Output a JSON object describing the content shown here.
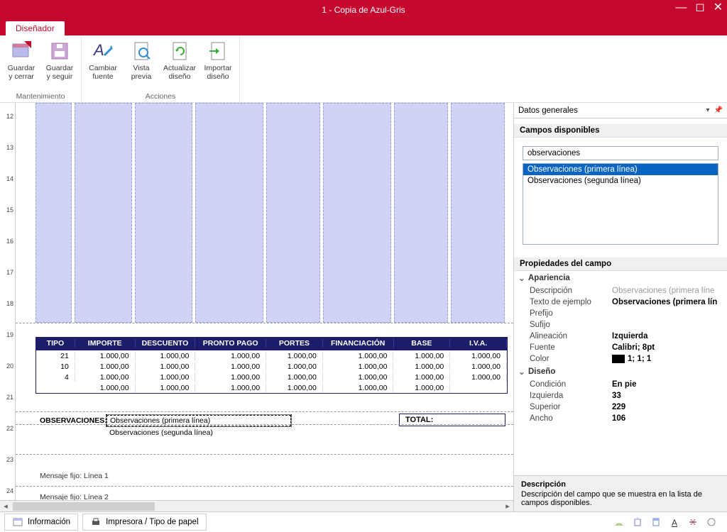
{
  "title": "1 - Copia de Azul-Gris",
  "tab": "Diseñador",
  "ribbon": {
    "groups": [
      {
        "title": "Mantenimiento",
        "items": [
          {
            "label": "Guardar y cerrar",
            "icon": "save-close"
          },
          {
            "label": "Guardar y seguir",
            "icon": "save"
          }
        ]
      },
      {
        "title": "Acciones",
        "items": [
          {
            "label": "Cambiar fuente",
            "icon": "font"
          },
          {
            "label": "Vista previa",
            "icon": "preview"
          },
          {
            "label": "Actualizar diseño",
            "icon": "refresh"
          },
          {
            "label": "Importar diseño",
            "icon": "import"
          }
        ]
      }
    ]
  },
  "ruler_ticks": [
    "12",
    "13",
    "14",
    "15",
    "16",
    "17",
    "18",
    "19",
    "20",
    "21",
    "22",
    "23",
    "24"
  ],
  "table": {
    "headers": [
      "TIPO",
      "IMPORTE",
      "DESCUENTO",
      "PRONTO PAGO",
      "PORTES",
      "FINANCIACIÓN",
      "BASE",
      "I.V.A."
    ],
    "widths": [
      55,
      85,
      85,
      100,
      80,
      100,
      80,
      80
    ],
    "rows": [
      [
        "21",
        "1.000,00",
        "1.000,00",
        "1.000,00",
        "1.000,00",
        "1.000,00",
        "1.000,00",
        "1.000,00"
      ],
      [
        "10",
        "1.000,00",
        "1.000,00",
        "1.000,00",
        "1.000,00",
        "1.000,00",
        "1.000,00",
        "1.000,00"
      ],
      [
        "4",
        "1.000,00",
        "1.000,00",
        "1.000,00",
        "1.000,00",
        "1.000,00",
        "1.000,00",
        "1.000,00"
      ],
      [
        "",
        "1.000,00",
        "1.000,00",
        "1.000,00",
        "1.000,00",
        "1.000,00",
        "1.000,00",
        ""
      ]
    ]
  },
  "obs_label": "OBSERVACIONES:",
  "obs_line1": "Observaciones (primera línea)",
  "obs_line2": "Observaciones (segunda línea)",
  "total_label": "TOTAL:",
  "msg1": "Mensaje fijo: Línea 1",
  "msg2": "Mensaje fijo: Línea 2",
  "side": {
    "dropdown": "Datos generales",
    "section_fields": "Campos disponibles",
    "search_value": "observaciones",
    "fields": [
      {
        "label": "Observaciones (primera línea)",
        "selected": true
      },
      {
        "label": "Observaciones (segunda línea)",
        "selected": false
      }
    ],
    "section_props": "Propiedades del campo",
    "cats": {
      "apariencia": "Apariencia",
      "diseno": "Diseño"
    },
    "props": [
      {
        "k": "Descripción",
        "v": "Observaciones (primera líne",
        "muted": true
      },
      {
        "k": "Texto de ejemplo",
        "v": "Observaciones (primera lín"
      },
      {
        "k": "Prefijo",
        "v": ""
      },
      {
        "k": "Sufijo",
        "v": ""
      },
      {
        "k": "Alineación",
        "v": "Izquierda"
      },
      {
        "k": "Fuente",
        "v": "Calibri; 8pt"
      },
      {
        "k": "Color",
        "v": "1; 1; 1",
        "color": true
      }
    ],
    "props2": [
      {
        "k": "Condición",
        "v": "En pie"
      },
      {
        "k": "Izquierda",
        "v": "33"
      },
      {
        "k": "Superior",
        "v": "229"
      },
      {
        "k": "Ancho",
        "v": "106"
      }
    ],
    "desc_title": "Descripción",
    "desc_text": "Descripción del campo que se muestra en la lista de campos disponibles."
  },
  "status": {
    "info": "Información",
    "printer": "Impresora / Tipo de papel"
  }
}
